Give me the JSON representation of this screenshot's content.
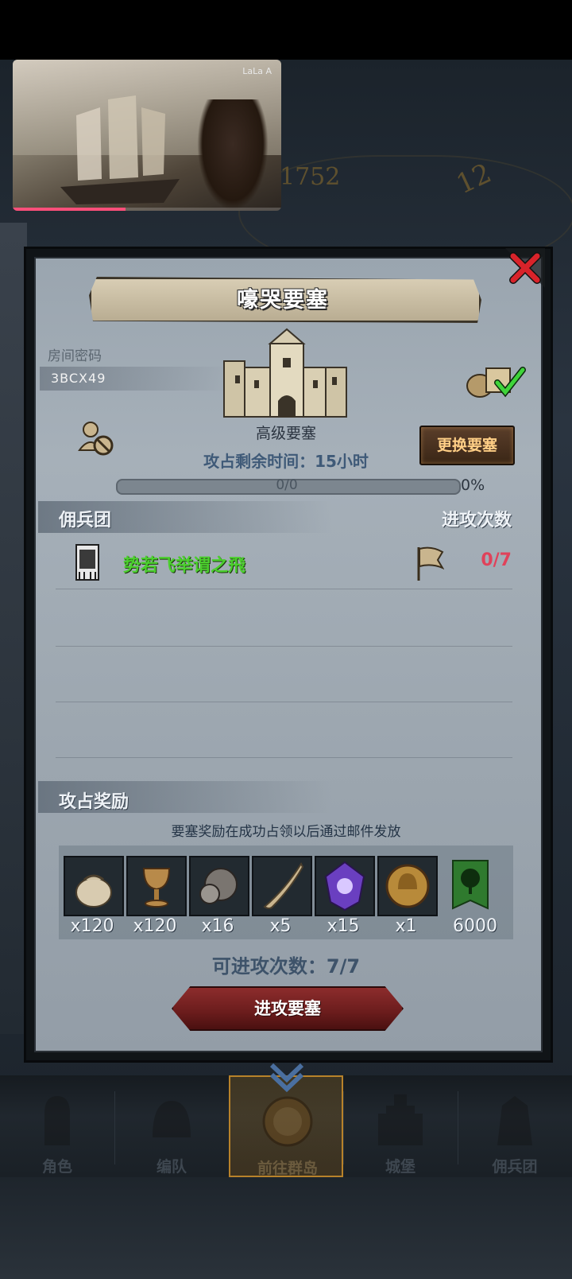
{
  "background": {
    "year_text": "1752",
    "clock_number": "12"
  },
  "video": {
    "watermark": "LaLa A",
    "caption": "",
    "progress_fraction": 0.42
  },
  "dialog": {
    "title": "嚎哭要塞",
    "password_label": "房间密码",
    "password_value": "3BCX49",
    "fortress_type": "高级要塞",
    "change_button": "更换要塞",
    "time_remaining": "攻占剩余时间：15小时",
    "progress_text": "0/0",
    "progress_percent": "0%",
    "mercenary_header": "佣兵团",
    "attack_count_header": "进攻次数",
    "mercenary_row": {
      "name": "势若飞举谓之飛",
      "count": "0/7"
    },
    "reward_header": "攻占奖励",
    "reward_note": "要塞奖励在成功占领以后通过邮件发放",
    "rewards": [
      {
        "icon": "sack-icon",
        "qty": "x120"
      },
      {
        "icon": "goblet-icon",
        "qty": "x120"
      },
      {
        "icon": "ore-icon",
        "qty": "x16"
      },
      {
        "icon": "horn-icon",
        "qty": "x5"
      },
      {
        "icon": "crystal-icon",
        "qty": "x15"
      },
      {
        "icon": "helmet-coin-icon",
        "qty": "x1"
      },
      {
        "icon": "tree-banner-icon",
        "qty": "6000"
      }
    ],
    "attacks_left": "可进攻次数：7/7",
    "attack_button": "进攻要塞"
  },
  "nav": [
    {
      "label": "角色",
      "icon": "knight-icon"
    },
    {
      "label": "编队",
      "icon": "helmet-icon"
    },
    {
      "label": "前往群岛",
      "icon": "compass-icon",
      "active": true
    },
    {
      "label": "城堡",
      "icon": "castle-icon"
    },
    {
      "label": "佣兵团",
      "icon": "mercenary-icon"
    }
  ],
  "colors": {
    "mercenary_name": "#4bcf2e",
    "attack_count": "#e0425a",
    "change_button_text": "#ffcf86",
    "active_nav_border": "#b8822a"
  }
}
